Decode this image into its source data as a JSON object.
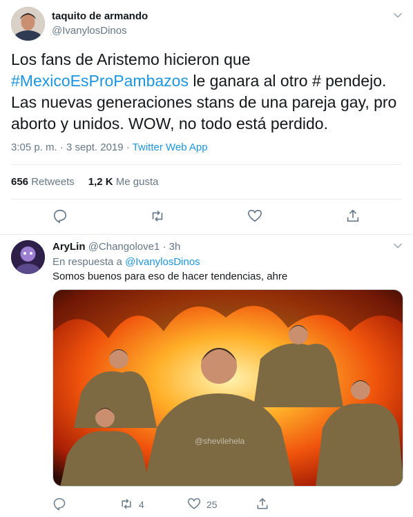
{
  "main_tweet": {
    "author_name": "taquito de armando",
    "author_handle": "@IvanylosDinos",
    "text_before": "Los fans de Aristemo hicieron que ",
    "hashtag": "#MexicoEsProPambazos",
    "text_after": " le ganara al otro # pendejo. Las nuevas generaciones stans de una pareja gay, pro aborto y unidos. WOW, no todo está perdido.",
    "timestamp": "3:05 p. m. · 3 sept. 2019 · ",
    "source": "Twitter Web App",
    "retweets_count": "656",
    "retweets_label": "Retweets",
    "likes_count": "1,2 K",
    "likes_label": "Me gusta"
  },
  "reply_tweet": {
    "author_name": "AryLin",
    "author_handle": "@Changolove1",
    "time": "3h",
    "replying_prefix": "En respuesta a ",
    "replying_to": "@IvanylosDinos",
    "text": "Somos buenos para eso de hacer tendencias, ahre",
    "media_watermark": "@shevilehela",
    "retweets": "4",
    "likes": "25"
  },
  "colors": {
    "accent": "#1b95e0",
    "secondary_text": "#657786",
    "primary_text": "#14171a",
    "border": "#e6ecf0"
  },
  "icons": [
    "chevron-down-icon",
    "reply-icon",
    "retweet-icon",
    "like-icon",
    "share-icon"
  ]
}
